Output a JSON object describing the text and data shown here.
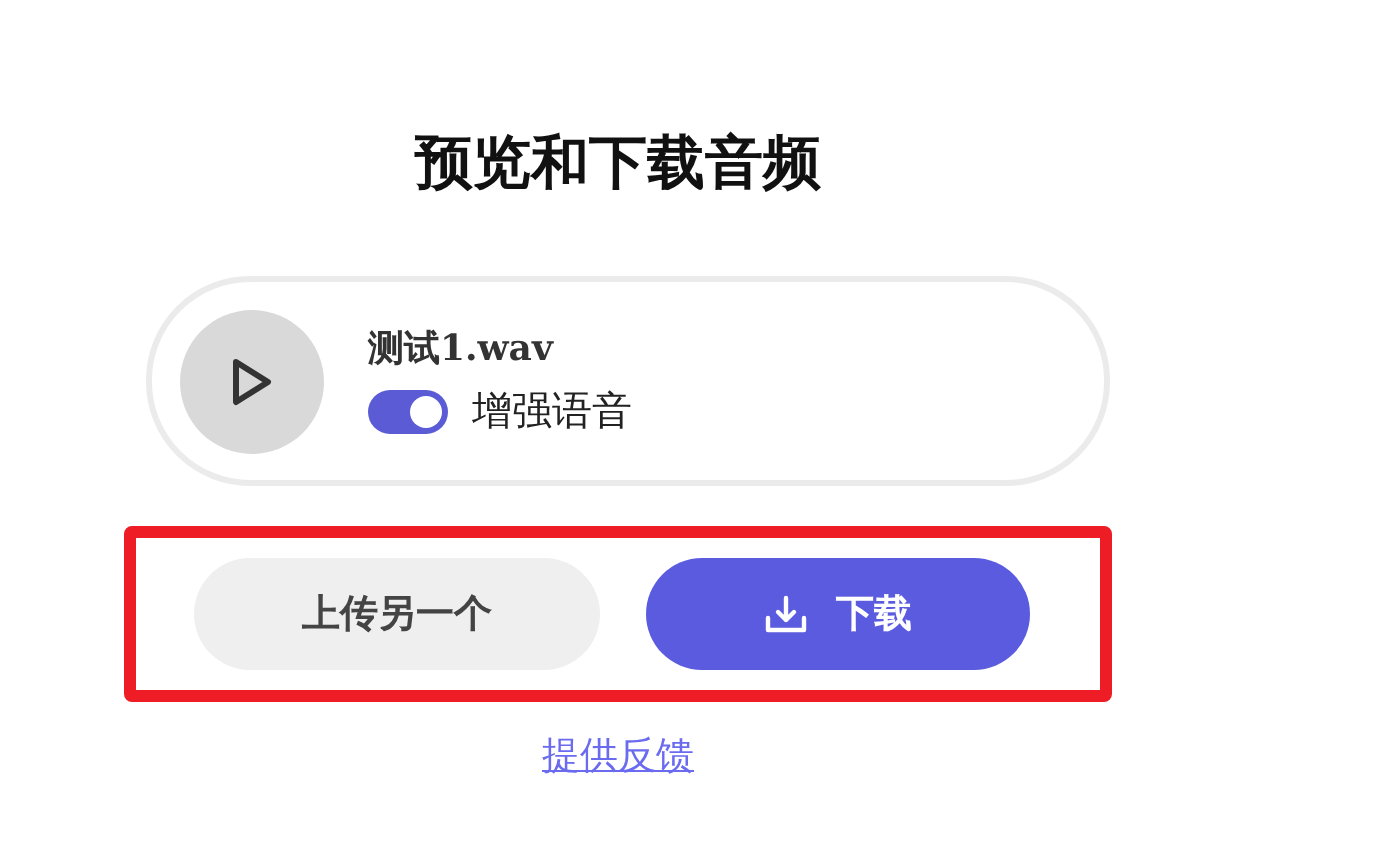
{
  "title": "预览和下载音频",
  "audio": {
    "file_name": "测试1.wav",
    "enhance": {
      "label": "增强语音",
      "on": true
    }
  },
  "highlighted": true,
  "buttons": [
    {
      "kind": "secondary",
      "label": "上传另一个"
    },
    {
      "kind": "primary",
      "label": "下载"
    }
  ],
  "feedback_link": "提供反馈"
}
